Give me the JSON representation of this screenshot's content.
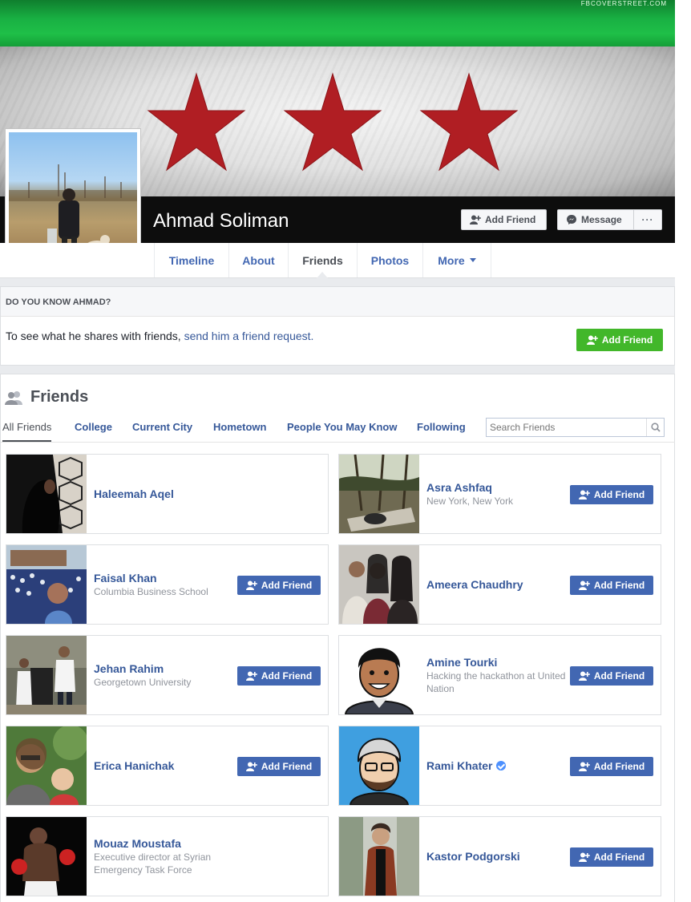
{
  "cover": {
    "watermark": "FBCOVERSTREET.COM"
  },
  "profile": {
    "name": "Ahmad Soliman"
  },
  "actions": {
    "add_friend": "Add Friend",
    "message": "Message",
    "more": "···"
  },
  "tabs": [
    {
      "label": "Timeline"
    },
    {
      "label": "About"
    },
    {
      "label": "Friends"
    },
    {
      "label": "Photos"
    },
    {
      "label": "More"
    }
  ],
  "know": {
    "heading": "DO YOU KNOW AHMAD?",
    "text": "To see what he shares with friends, ",
    "link": "send him a friend request.",
    "button": "Add Friend"
  },
  "friends_section": {
    "title": "Friends",
    "filters": [
      "All Friends",
      "College",
      "Current City",
      "Hometown",
      "People You May Know",
      "Following"
    ],
    "search_placeholder": "Search Friends",
    "add_label": "Add Friend"
  },
  "friends": [
    {
      "name": "Haleemah Aqel",
      "sub": ""
    },
    {
      "name": "Asra Ashfaq",
      "sub": "New York, New York"
    },
    {
      "name": "Faisal Khan",
      "sub": "Columbia Business School"
    },
    {
      "name": "Ameera Chaudhry",
      "sub": ""
    },
    {
      "name": "Jehan Rahim",
      "sub": "Georgetown University"
    },
    {
      "name": "Amine Tourki",
      "sub": "Hacking the hackathon at United Nation"
    },
    {
      "name": "Erica Hanichak",
      "sub": ""
    },
    {
      "name": "Rami Khater",
      "sub": ""
    },
    {
      "name": "Mouaz Moustafa",
      "sub": "Executive director at Syrian Emergency Task Force"
    },
    {
      "name": "Kastor Podgorski",
      "sub": ""
    }
  ],
  "colors": {
    "link_blue": "#365899",
    "button_blue": "#4267b2",
    "green": "#42b72a",
    "star_red": "#b01e23"
  }
}
